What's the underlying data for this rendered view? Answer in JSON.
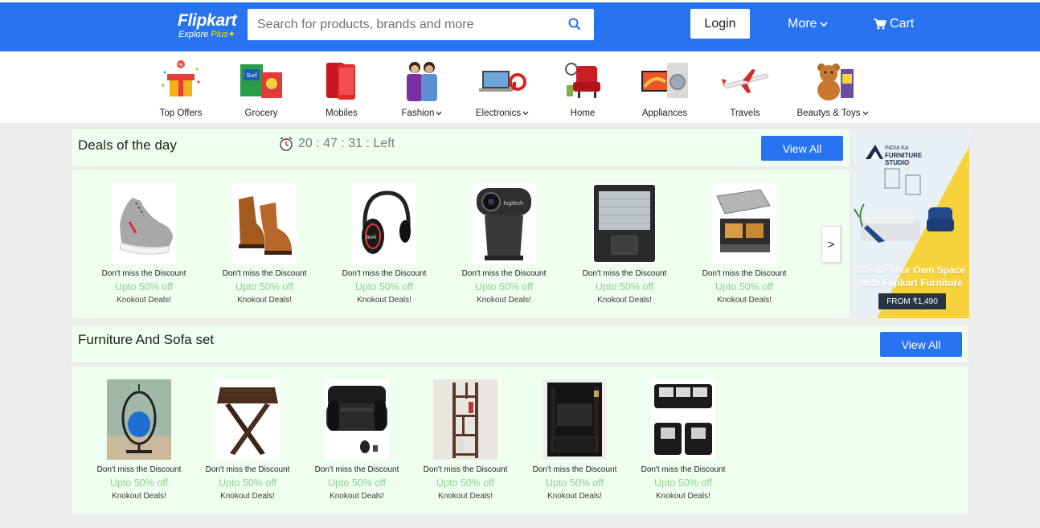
{
  "header": {
    "brand": "Flipkart",
    "tagline_a": "Explore",
    "tagline_b": "Plus",
    "search_placeholder": "Search for products, brands and more",
    "login_label": "Login",
    "more_label": "More",
    "cart_label": "Cart"
  },
  "categories": [
    {
      "label": "Top Offers",
      "has_dropdown": false
    },
    {
      "label": "Grocery",
      "has_dropdown": false
    },
    {
      "label": "Mobiles",
      "has_dropdown": false
    },
    {
      "label": "Fashion",
      "has_dropdown": true
    },
    {
      "label": "Electronics",
      "has_dropdown": true
    },
    {
      "label": "Home",
      "has_dropdown": false
    },
    {
      "label": "Appliances",
      "has_dropdown": false
    },
    {
      "label": "Travels",
      "has_dropdown": false
    },
    {
      "label": "Beautys & Toys",
      "has_dropdown": true
    }
  ],
  "deals": {
    "title": "Deals of the day",
    "timer": "20 : 47 : 31 : Left",
    "view_all": "View All",
    "next_label": ">",
    "items": [
      {
        "name": "Don't miss the Discount",
        "offer": "Upto 50% off",
        "tag": "Knokout Deals!",
        "image": "sneaker"
      },
      {
        "name": "Don't miss the Discount",
        "offer": "Upto 50% off",
        "tag": "Knokout Deals!",
        "image": "boots"
      },
      {
        "name": "Don't miss the Discount",
        "offer": "Upto 50% off",
        "tag": "Knokout Deals!",
        "image": "headphones"
      },
      {
        "name": "Don't miss the Discount",
        "offer": "Upto 50% off",
        "tag": "Knokout Deals!",
        "image": "webcam"
      },
      {
        "name": "Don't miss the Discount",
        "offer": "Upto 50% off",
        "tag": "Knokout Deals!",
        "image": "keyboard-cover"
      },
      {
        "name": "Don't miss the Discount",
        "offer": "Upto 50% off",
        "tag": "Knokout Deals!",
        "image": "sandwich-grill"
      }
    ]
  },
  "furniture": {
    "title": "Furniture And Sofa set",
    "view_all": "View All",
    "items": [
      {
        "name": "Don't miss the Discount",
        "offer": "Upto 50% off",
        "tag": "Knokout Deals!",
        "image": "hanging-chair"
      },
      {
        "name": "Don't miss the Discount",
        "offer": "Upto 50% off",
        "tag": "Knokout Deals!",
        "image": "folding-stool"
      },
      {
        "name": "Don't miss the Discount",
        "offer": "Upto 50% off",
        "tag": "Knokout Deals!",
        "image": "inflatable-sofa"
      },
      {
        "name": "Don't miss the Discount",
        "offer": "Upto 50% off",
        "tag": "Knokout Deals!",
        "image": "bookshelf"
      },
      {
        "name": "Don't miss the Discount",
        "offer": "Upto 50% off",
        "tag": "Knokout Deals!",
        "image": "tv-unit"
      },
      {
        "name": "Don't miss the Discount",
        "offer": "Upto 50% off",
        "tag": "Knokout Deals!",
        "image": "sofa-set"
      }
    ]
  },
  "ad": {
    "brand_line1": "INDIA KA",
    "brand_line2": "FURNITURE",
    "brand_line3": "STUDIO",
    "caption_line1": "Create Your Own Space",
    "caption_line2": "With Flipkart Furniture",
    "price": "FROM ₹1,490"
  },
  "colors": {
    "primary": "#2874f0",
    "panel_bg": "#eeffef",
    "offer_green": "#8ecf8e",
    "ad_yellow": "#f6d33a"
  }
}
